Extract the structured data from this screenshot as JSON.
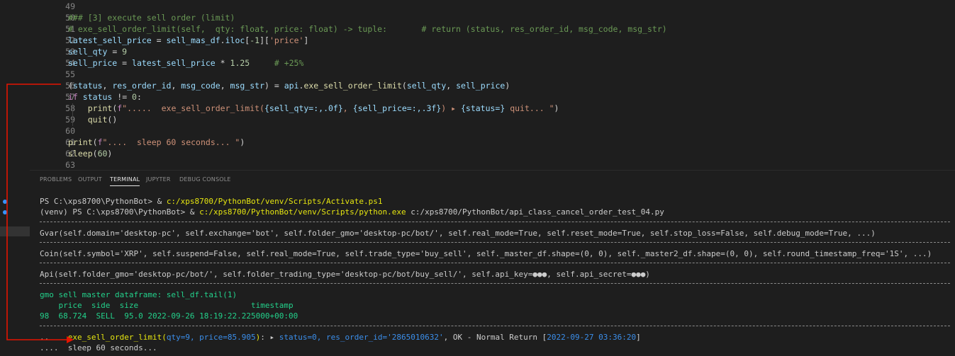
{
  "editor": {
    "lines": [
      {
        "n": "49",
        "parts": []
      },
      {
        "n": "50",
        "parts": [
          {
            "c": "c-cm",
            "t": "### [3] execute sell order (limit)"
          }
        ]
      },
      {
        "n": "51",
        "parts": [
          {
            "c": "c-cm",
            "t": "# exe_sell_order_limit(self,  qty: float, price: float) -> tuple:       # return (status, res_order_id, msg_code, msg_str)"
          }
        ]
      },
      {
        "n": "52",
        "parts": [
          {
            "c": "c-var",
            "t": "latest_sell_price"
          },
          {
            "c": "c-op",
            "t": " = "
          },
          {
            "c": "c-var",
            "t": "sell_mas_df"
          },
          {
            "c": "c-op",
            "t": "."
          },
          {
            "c": "c-var",
            "t": "iloc"
          },
          {
            "c": "c-op",
            "t": "["
          },
          {
            "c": "c-num",
            "t": "-1"
          },
          {
            "c": "c-op",
            "t": "]["
          },
          {
            "c": "c-str",
            "t": "'price'"
          },
          {
            "c": "c-op",
            "t": "]"
          }
        ]
      },
      {
        "n": "53",
        "parts": [
          {
            "c": "c-var",
            "t": "sell_qty"
          },
          {
            "c": "c-op",
            "t": " = "
          },
          {
            "c": "c-num",
            "t": "9"
          }
        ]
      },
      {
        "n": "54",
        "parts": [
          {
            "c": "c-var",
            "t": "sell_price"
          },
          {
            "c": "c-op",
            "t": " = "
          },
          {
            "c": "c-var",
            "t": "latest_sell_price"
          },
          {
            "c": "c-op",
            "t": " * "
          },
          {
            "c": "c-num",
            "t": "1.25"
          },
          {
            "c": "c-op",
            "t": "     "
          },
          {
            "c": "c-cm",
            "t": "# +25%"
          }
        ]
      },
      {
        "n": "55",
        "parts": []
      },
      {
        "n": "56",
        "parts": [
          {
            "c": "c-op",
            "t": "("
          },
          {
            "c": "c-var",
            "t": "status"
          },
          {
            "c": "c-op",
            "t": ", "
          },
          {
            "c": "c-var",
            "t": "res_order_id"
          },
          {
            "c": "c-op",
            "t": ", "
          },
          {
            "c": "c-var",
            "t": "msg_code"
          },
          {
            "c": "c-op",
            "t": ", "
          },
          {
            "c": "c-var",
            "t": "msg_str"
          },
          {
            "c": "c-op",
            "t": ") = "
          },
          {
            "c": "c-var",
            "t": "api"
          },
          {
            "c": "c-op",
            "t": "."
          },
          {
            "c": "c-fn",
            "t": "exe_sell_order_limit"
          },
          {
            "c": "c-op",
            "t": "("
          },
          {
            "c": "c-var",
            "t": "sell_qty"
          },
          {
            "c": "c-op",
            "t": ", "
          },
          {
            "c": "c-var",
            "t": "sell_price"
          },
          {
            "c": "c-op",
            "t": ")"
          }
        ]
      },
      {
        "n": "57",
        "parts": [
          {
            "c": "c-kw",
            "t": "if"
          },
          {
            "c": "c-op",
            "t": " "
          },
          {
            "c": "c-var",
            "t": "status"
          },
          {
            "c": "c-op",
            "t": " != "
          },
          {
            "c": "c-num",
            "t": "0"
          },
          {
            "c": "c-op",
            "t": ":"
          }
        ]
      },
      {
        "n": "58",
        "parts": [
          {
            "c": "c-op",
            "t": "    "
          },
          {
            "c": "c-fn",
            "t": "print"
          },
          {
            "c": "c-op",
            "t": "("
          },
          {
            "c": "c-kw",
            "t": "f"
          },
          {
            "c": "c-str",
            "t": "\".....  exe_sell_order_limit("
          },
          {
            "c": "c-var",
            "t": "{sell_qty=:,.0f}"
          },
          {
            "c": "c-str",
            "t": ", "
          },
          {
            "c": "c-var",
            "t": "{sell_price=:,.3f}"
          },
          {
            "c": "c-str",
            "t": ") ▸ "
          },
          {
            "c": "c-var",
            "t": "{status=}"
          },
          {
            "c": "c-str",
            "t": " quit... \""
          },
          {
            "c": "c-op",
            "t": ")"
          }
        ]
      },
      {
        "n": "59",
        "parts": [
          {
            "c": "c-op",
            "t": "    "
          },
          {
            "c": "c-fn",
            "t": "quit"
          },
          {
            "c": "c-op",
            "t": "()"
          }
        ]
      },
      {
        "n": "60",
        "parts": []
      },
      {
        "n": "61",
        "parts": [
          {
            "c": "c-fn",
            "t": "print"
          },
          {
            "c": "c-op",
            "t": "("
          },
          {
            "c": "c-kw",
            "t": "f"
          },
          {
            "c": "c-str",
            "t": "\"....  sleep 60 seconds... \""
          },
          {
            "c": "c-op",
            "t": ")"
          }
        ]
      },
      {
        "n": "62",
        "parts": [
          {
            "c": "c-fn",
            "t": "sleep"
          },
          {
            "c": "c-op",
            "t": "("
          },
          {
            "c": "c-num",
            "t": "60"
          },
          {
            "c": "c-op",
            "t": ")"
          }
        ]
      },
      {
        "n": "63",
        "parts": []
      }
    ]
  },
  "panel": {
    "tabs": [
      {
        "label": "PROBLEMS",
        "active": false
      },
      {
        "label": "OUTPUT",
        "active": false
      },
      {
        "label": "TERMINAL",
        "active": true
      },
      {
        "label": "JUPYTER",
        "active": false
      },
      {
        "label": "DEBUG CONSOLE",
        "active": false
      }
    ]
  },
  "terminal": {
    "lines": [
      {
        "kind": "text",
        "dot": true,
        "parts": [
          {
            "c": "t-w",
            "t": "PS C:\\xps8700\\PythonBot> & "
          },
          {
            "c": "t-y",
            "t": "c:/xps8700/PythonBot/venv/Scripts/Activate.ps1"
          }
        ]
      },
      {
        "kind": "text",
        "dot": true,
        "parts": [
          {
            "c": "t-w",
            "t": "(venv) PS C:\\xps8700\\PythonBot> & "
          },
          {
            "c": "t-y",
            "t": "c:/xps8700/PythonBot/venv/Scripts/python.exe"
          },
          {
            "c": "t-w",
            "t": " c:/xps8700/PythonBot/api_class_cancel_order_test_04.py"
          }
        ]
      },
      {
        "kind": "sep"
      },
      {
        "kind": "text",
        "parts": [
          {
            "c": "t-w",
            "t": "Gvar(self.domain='desktop-pc', self.exchange='bot', self.folder_gmo='desktop-pc/bot/', self.real_mode=True, self.reset_mode=True, self.stop_loss=False, self.debug_mode=True, ...)"
          }
        ]
      },
      {
        "kind": "sep"
      },
      {
        "kind": "text",
        "parts": [
          {
            "c": "t-w",
            "t": "Coin(self.symbol='XRP', self.suspend=False, self.real_mode=True, self.trade_type='buy_sell', self._master_df.shape=(0, 0), self._master2_df.shape=(0, 0), self.round_timestamp_freq='1S', ...)"
          }
        ]
      },
      {
        "kind": "sep"
      },
      {
        "kind": "text",
        "parts": [
          {
            "c": "t-w",
            "t": "Api(self.folder_gmo='desktop-pc/bot/', self.folder_trading_type='desktop-pc/bot/buy_sell/', self.api_key=●●●, self.api_secret=●●●)"
          }
        ]
      },
      {
        "kind": "sep"
      },
      {
        "kind": "text",
        "parts": [
          {
            "c": "t-g",
            "t": "gmo sell master dataframe: sell_df.tail(1)"
          }
        ]
      },
      {
        "kind": "text",
        "parts": [
          {
            "c": "t-g",
            "t": "    price  side  size                        timestamp"
          }
        ]
      },
      {
        "kind": "text",
        "parts": [
          {
            "c": "t-g",
            "t": "98  68.724  SELL  95.0 2022-09-26 18:19:22.225000+00:00"
          }
        ]
      },
      {
        "kind": "sep"
      },
      {
        "kind": "text",
        "parts": [
          {
            "c": "t-w",
            "t": ".."
          },
          {
            "c": "t-w",
            "t": "    "
          },
          {
            "c": "t-y",
            "t": "exe_sell_order_limit("
          },
          {
            "c": "t-b",
            "t": "qty=9, price=85.905"
          },
          {
            "c": "t-y",
            "t": ")"
          },
          {
            "c": "t-w",
            "t": ": ▸ "
          },
          {
            "c": "t-b",
            "t": "status=0, res_order_id='2865010632'"
          },
          {
            "c": "t-w",
            "t": ", OK - Normal Return ["
          },
          {
            "c": "t-b",
            "t": "2022-09-27 03:36:20"
          },
          {
            "c": "t-w",
            "t": "]"
          }
        ]
      },
      {
        "kind": "text",
        "parts": [
          {
            "c": "t-w",
            "t": "....  sleep 60 seconds..."
          }
        ]
      }
    ]
  },
  "colors": {
    "arrow": "#e51400",
    "background": "#1e1e1e"
  }
}
